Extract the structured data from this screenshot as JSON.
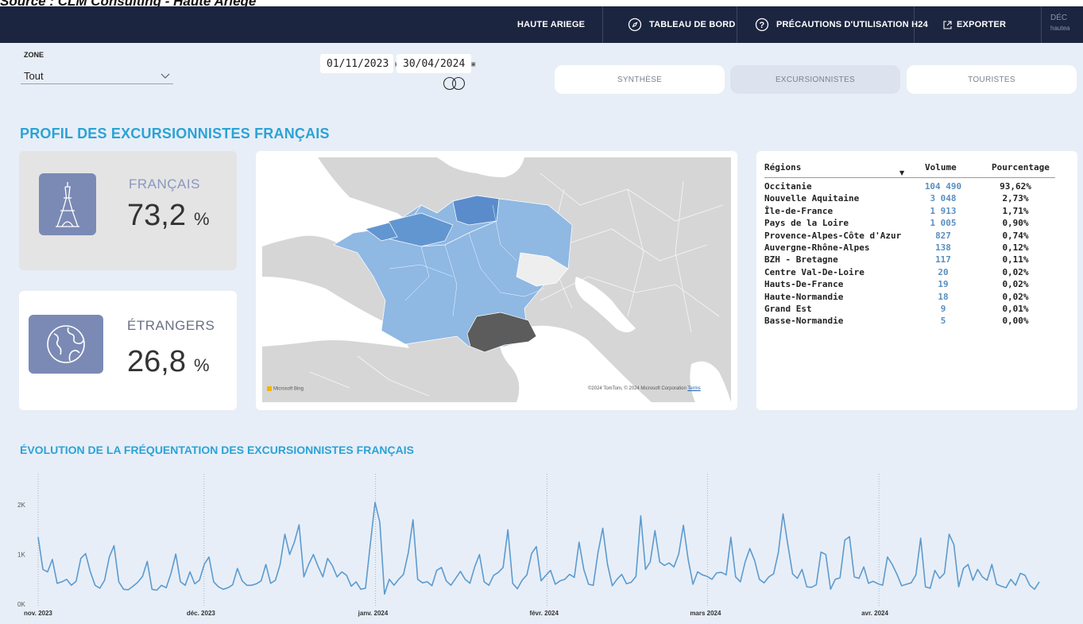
{
  "caption": "Source : CLM Consulting - Haute Ariege",
  "topbar": {
    "area": "HAUTE ARIEGE",
    "nav": [
      {
        "label": "TABLEAU DE BORD",
        "icon": "compass-icon"
      },
      {
        "label": "PRÉCAUTIONS D'UTILISATION H24",
        "icon": "help-circle-icon"
      },
      {
        "label": "EXPORTER",
        "icon": "external-link-icon"
      }
    ],
    "right_label": "DÉC",
    "right_sub": "hautea"
  },
  "filters": {
    "zone_label": "ZONE",
    "zone_value": "Tout",
    "date_start": "01/11/2023",
    "date_end": "30/04/2024"
  },
  "tabs": [
    {
      "label": "SYNTHÈSE",
      "active": false
    },
    {
      "label": "EXCURSIONNISTES",
      "active": true
    },
    {
      "label": "TOURISTES",
      "active": false
    }
  ],
  "section1_title": "PROFIL DES EXCURSIONNISTES FRANÇAIS",
  "kpis": {
    "francais": {
      "label": "FRANÇAIS",
      "value": "73,2",
      "unit": "%",
      "icon": "eiffel-tower-icon",
      "label_color": "#8a97bf"
    },
    "etrangers": {
      "label": "ÉTRANGERS",
      "value": "26,8",
      "unit": "%",
      "icon": "globe-icon",
      "label_color": "#6a6f86"
    }
  },
  "map": {
    "bing_logo": "Microsoft Bing",
    "copyright": "©2024 TomTom, © 2024 Microsoft Corporation",
    "terms": "Terms",
    "colors": {
      "land": "#d6d6d6",
      "sea": "#ffffff",
      "region": "#8fb8e3",
      "region_dark": "#4a7fc4",
      "selected": "#5c5c5c"
    }
  },
  "table": {
    "headers": {
      "region": "Régions",
      "volume": "Volume",
      "percent": "Pourcentage"
    },
    "rows": [
      {
        "region": "Occitanie",
        "volume": "104 490",
        "percent": "93,62%"
      },
      {
        "region": "Nouvelle Aquitaine",
        "volume": "3 048",
        "percent": "2,73%"
      },
      {
        "region": "Île-de-France",
        "volume": "1 913",
        "percent": "1,71%"
      },
      {
        "region": "Pays de la Loire",
        "volume": "1 005",
        "percent": "0,90%"
      },
      {
        "region": "Provence-Alpes-Côte d'Azur",
        "volume": "827",
        "percent": "0,74%"
      },
      {
        "region": "Auvergne-Rhône-Alpes",
        "volume": "138",
        "percent": "0,12%"
      },
      {
        "region": "BZH - Bretagne",
        "volume": "117",
        "percent": "0,11%"
      },
      {
        "region": "Centre Val-De-Loire",
        "volume": "20",
        "percent": "0,02%"
      },
      {
        "region": "Hauts-De-France",
        "volume": "19",
        "percent": "0,02%"
      },
      {
        "region": "Haute-Normandie",
        "volume": "18",
        "percent": "0,02%"
      },
      {
        "region": "Grand Est",
        "volume": "9",
        "percent": "0,01%"
      },
      {
        "region": "Basse-Normandie",
        "volume": "5",
        "percent": "0,00%"
      }
    ]
  },
  "section2_title": "ÉVOLUTION DE LA FRÉQUENTATION DES EXCURSIONNISTES FRANÇAIS",
  "chart_data": {
    "type": "line",
    "title": "ÉVOLUTION DE LA FRÉQUENTATION DES EXCURSIONNISTES FRANÇAIS",
    "xlabel": "",
    "ylabel": "",
    "ylim": [
      0,
      2500
    ],
    "y_ticks": [
      {
        "value": 0,
        "label": "0K"
      },
      {
        "value": 1000,
        "label": "1K"
      },
      {
        "value": 2000,
        "label": "2K"
      }
    ],
    "x_range": [
      "2023-11-01",
      "2024-04-30"
    ],
    "x_ticks": [
      {
        "date": "2023-11-01",
        "label": "nov. 2023"
      },
      {
        "date": "2023-12-01",
        "label": "déc. 2023"
      },
      {
        "date": "2024-01-01",
        "label": "janv. 2024"
      },
      {
        "date": "2024-02-01",
        "label": "févr. 2024"
      },
      {
        "date": "2024-03-01",
        "label": "mars 2024"
      },
      {
        "date": "2024-04-01",
        "label": "avr. 2024"
      }
    ],
    "grid": false,
    "line_color": "#5b9bd0",
    "series": [
      {
        "values": [
          1350,
          700,
          650,
          900,
          420,
          450,
          500,
          380,
          460,
          920,
          1020,
          650,
          380,
          320,
          480,
          950,
          1180,
          450,
          300,
          290,
          360,
          440,
          560,
          860,
          300,
          280,
          380,
          330,
          620,
          1010,
          450,
          380,
          650,
          410,
          480,
          800,
          950,
          450,
          350,
          300,
          330,
          390,
          720,
          470,
          380,
          380,
          410,
          470,
          800,
          420,
          480,
          800,
          1410,
          1000,
          1250,
          1600,
          550,
          800,
          1000,
          760,
          550,
          920,
          780,
          550,
          650,
          580,
          360,
          450,
          300,
          320,
          1200,
          2050,
          1650,
          200,
          500,
          380,
          500,
          600,
          1030,
          1700,
          500,
          430,
          450,
          370,
          680,
          740,
          470,
          380,
          520,
          660,
          500,
          420,
          750,
          1000,
          450,
          380,
          580,
          640,
          740,
          1500,
          420,
          310,
          480,
          590,
          1020,
          1160,
          470,
          580,
          680,
          400,
          470,
          500,
          600,
          540,
          1250,
          700,
          400,
          380,
          1040,
          1530,
          800,
          370,
          500,
          600,
          410,
          440,
          560,
          1780,
          700,
          850,
          1480,
          850,
          780,
          830,
          750,
          1010,
          1590,
          900,
          400,
          650,
          590,
          560,
          500,
          630,
          640,
          590,
          1350,
          550,
          450,
          850,
          1120,
          880,
          500,
          430,
          550,
          610,
          1040,
          1820,
          1200,
          610,
          520,
          700,
          350,
          340,
          390,
          1050,
          1000,
          300,
          500,
          530,
          1290,
          1360,
          550,
          520,
          750,
          420,
          460,
          410,
          380,
          950,
          800,
          600,
          370,
          400,
          430,
          590,
          1330,
          350,
          320,
          680,
          520,
          620,
          1410,
          1200,
          350,
          720,
          800,
          480,
          700,
          550,
          480,
          800,
          400,
          360,
          330,
          500,
          380,
          620,
          580,
          380,
          300,
          450
        ]
      }
    ]
  }
}
